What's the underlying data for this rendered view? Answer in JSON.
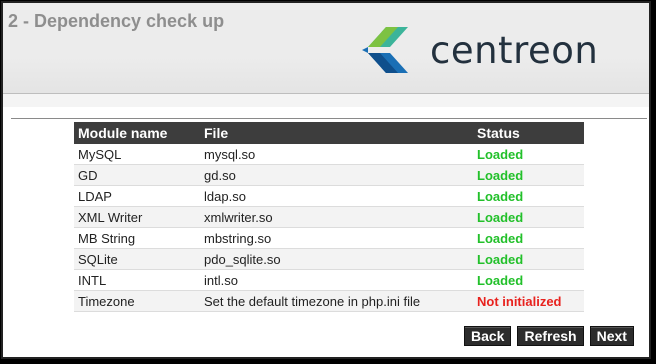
{
  "header": {
    "title": "2 - Dependency check up",
    "logo_text": "centreon",
    "logo_colors": [
      "#1a6fb5",
      "#3cb49a",
      "#7dc242",
      "#0f4f8c"
    ]
  },
  "table": {
    "columns": [
      "Module name",
      "File",
      "Status"
    ],
    "rows": [
      {
        "name": "MySQL",
        "file": "mysql.so",
        "status": "Loaded",
        "status_color": "#22c02a"
      },
      {
        "name": "GD",
        "file": "gd.so",
        "status": "Loaded",
        "status_color": "#22c02a"
      },
      {
        "name": "LDAP",
        "file": "ldap.so",
        "status": "Loaded",
        "status_color": "#22c02a"
      },
      {
        "name": "XML Writer",
        "file": "xmlwriter.so",
        "status": "Loaded",
        "status_color": "#22c02a"
      },
      {
        "name": "MB String",
        "file": "mbstring.so",
        "status": "Loaded",
        "status_color": "#22c02a"
      },
      {
        "name": "SQLite",
        "file": "pdo_sqlite.so",
        "status": "Loaded",
        "status_color": "#22c02a"
      },
      {
        "name": "INTL",
        "file": "intl.so",
        "status": "Loaded",
        "status_color": "#22c02a"
      },
      {
        "name": "Timezone",
        "file": "Set the default timezone in php.ini file",
        "status": "Not initialized",
        "status_color": "#e8221e"
      }
    ]
  },
  "buttons": {
    "back_label": "Back",
    "refresh_label": "Refresh",
    "next_label": "Next"
  }
}
